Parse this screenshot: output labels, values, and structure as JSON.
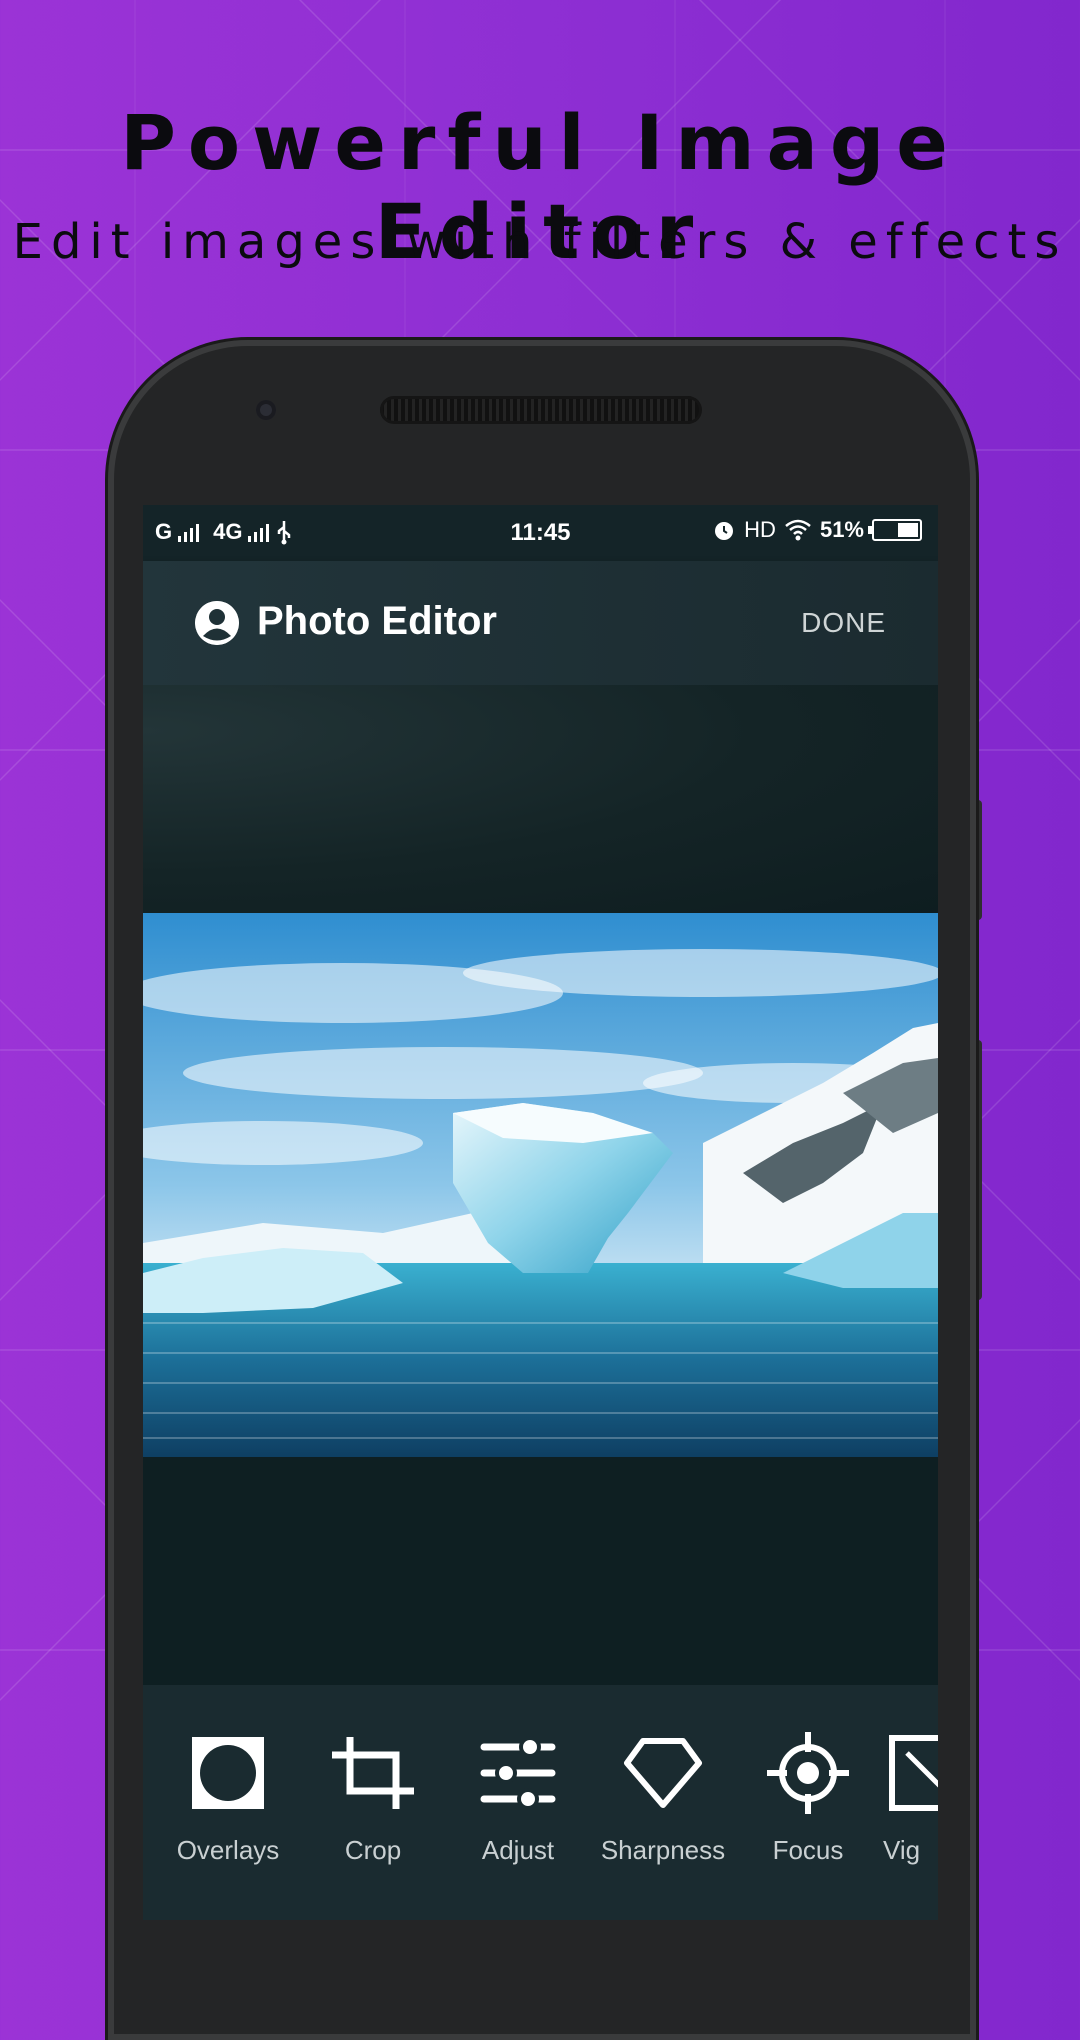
{
  "promo": {
    "title": "Powerful Image Editor",
    "subtitle": "Edit images with filters & effects"
  },
  "status_bar": {
    "network1": "G",
    "network2": "4G",
    "time": "11:45",
    "hd": "HD",
    "battery": "51%",
    "battery_level": 0.51
  },
  "app_bar": {
    "title": "Photo Editor",
    "done_label": "DONE"
  },
  "tools": [
    {
      "label": "Overlays",
      "icon": "overlays-icon"
    },
    {
      "label": "Crop",
      "icon": "crop-icon"
    },
    {
      "label": "Adjust",
      "icon": "adjust-icon"
    },
    {
      "label": "Sharpness",
      "icon": "sharpness-icon"
    },
    {
      "label": "Focus",
      "icon": "focus-icon"
    },
    {
      "label": "Vig",
      "icon": "vignette-icon"
    }
  ],
  "colors": {
    "background": "#8e2fd3",
    "screen": "#0f2022",
    "app_bar": "#1f3136",
    "toolbar": "#1a2b30"
  }
}
